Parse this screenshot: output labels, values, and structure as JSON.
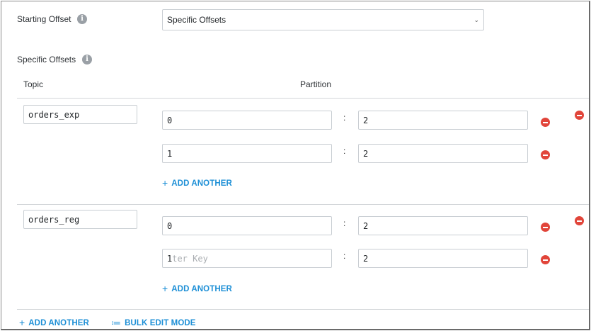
{
  "starting_offset": {
    "label": "Starting Offset",
    "info_glyph": "i",
    "select_value": "Specific Offsets",
    "chevron_glyph": "⌄"
  },
  "specific_offsets": {
    "label": "Specific Offsets",
    "info_glyph": "i",
    "columns": {
      "topic": "Topic",
      "partition": "Partition"
    },
    "colon": ":",
    "groups": [
      {
        "topic": "orders_exp",
        "rows": [
          {
            "partition": "0",
            "offset": "2"
          },
          {
            "partition": "1",
            "offset": "2"
          }
        ],
        "add_another": "ADD ANOTHER"
      },
      {
        "topic": "orders_reg",
        "rows": [
          {
            "partition": "0",
            "offset": "2"
          },
          {
            "partition": "1",
            "partition_placeholder": "ter Key",
            "offset": "2"
          }
        ],
        "add_another": "ADD ANOTHER"
      }
    ],
    "footer": {
      "add_another": "ADD ANOTHER",
      "bulk_edit": "BULK EDIT MODE"
    }
  },
  "icons": {
    "plus": "+",
    "list": "≔",
    "remove_color": "#e1453a",
    "link_color": "#1d8fd6"
  }
}
